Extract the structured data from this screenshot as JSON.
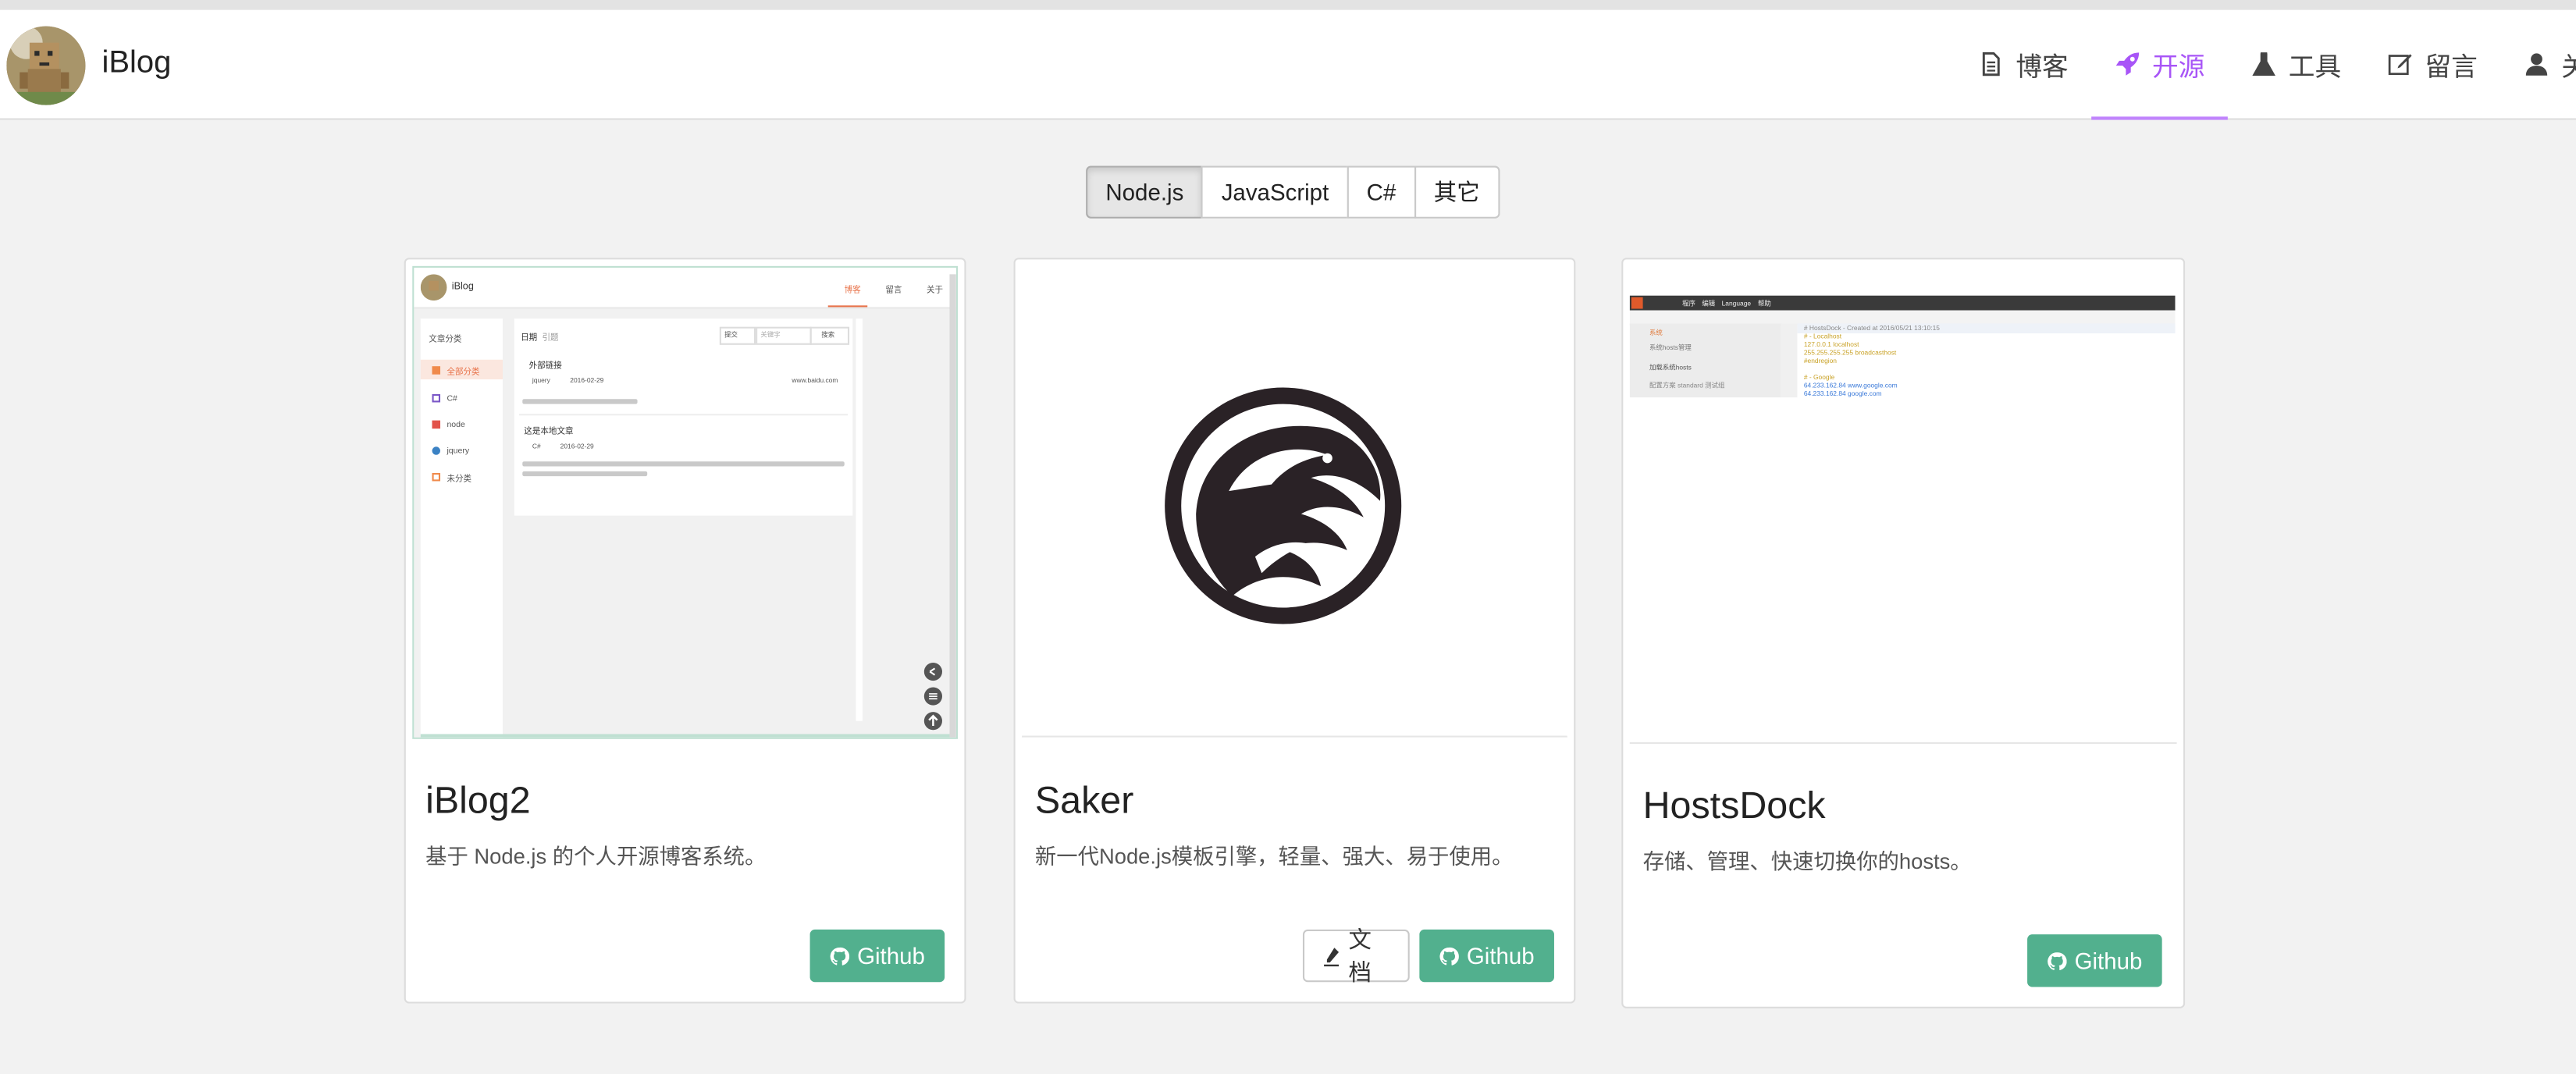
{
  "site": {
    "brand": "iBlog"
  },
  "nav": {
    "items": [
      {
        "label": "博客",
        "icon": "file-icon",
        "active": false
      },
      {
        "label": "开源",
        "icon": "rocket-icon",
        "active": true
      },
      {
        "label": "工具",
        "icon": "flask-icon",
        "active": false
      },
      {
        "label": "留言",
        "icon": "edit-icon",
        "active": false
      },
      {
        "label": "关于",
        "icon": "user-icon",
        "active": false
      }
    ]
  },
  "filters": {
    "items": [
      "Node.js",
      "JavaScript",
      "C#",
      "其它"
    ],
    "selected": "Node.js"
  },
  "projects": [
    {
      "title": "iBlog2",
      "description": "基于 Node.js 的个人开源博客系统。",
      "github_label": "Github",
      "thumb": {
        "brand": "iBlog",
        "nav": [
          "博客",
          "留言",
          "关于"
        ],
        "sidebar_title": "文章分类",
        "categories": [
          "全部分类",
          "C#",
          "node",
          "jquery",
          "未分类"
        ],
        "list_title": "日期",
        "list_subtitle": "引题",
        "sort_label": "提交",
        "search_placeholder": "关键字",
        "search_button": "搜索",
        "posts": [
          {
            "title": "外部链接",
            "category": "jquery",
            "date": "2016-02-29",
            "link": "www.baidu.com"
          },
          {
            "title": "这是本地文章",
            "category": "C#",
            "date": "2016-02-29"
          }
        ]
      }
    },
    {
      "title": "Saker",
      "description": "新一代Node.js模板引擎，轻量、强大、易于使用。",
      "docs_label": "文档",
      "github_label": "Github"
    },
    {
      "title": "HostsDock",
      "description": "存储、管理、快速切换你的hosts。",
      "github_label": "Github",
      "thumb": {
        "menu": [
          "程序",
          "编辑",
          "Language",
          "帮助"
        ],
        "side_items": [
          "系统",
          "系统hosts管理",
          "加载系统hosts",
          "配置方案 standard 测试组"
        ],
        "code_lines": [
          "# HostsDock - Created at 2016/05/21 13:10:15",
          "# - Localhost",
          "127.0.0.1 localhost",
          "255.255.255.255 broadcasthost",
          "#endregion",
          "",
          "# - Google",
          "64.233.162.84   www.google.com",
          "64.233.162.84   google.com"
        ]
      }
    }
  ],
  "colors": {
    "accent": "#a855f7",
    "github_button": "#52b08e"
  }
}
